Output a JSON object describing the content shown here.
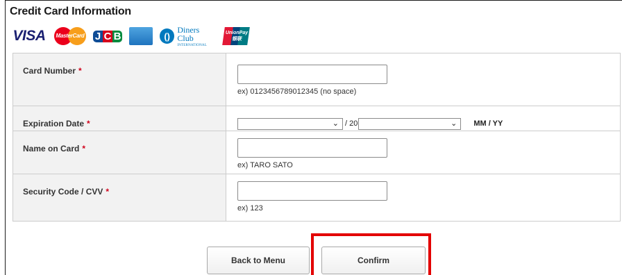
{
  "section": {
    "title": "Credit Card Information"
  },
  "logos": [
    {
      "name": "visa",
      "text": "VISA"
    },
    {
      "name": "mastercard",
      "text": "MasterCard"
    },
    {
      "name": "jcb",
      "text": "JCB"
    },
    {
      "name": "american-express",
      "text": ""
    },
    {
      "name": "diners-club",
      "text": "Diners Club",
      "subtext": "INTERNATIONAL"
    },
    {
      "name": "unionpay",
      "text": "UnionPay",
      "subtext": "银联"
    }
  ],
  "form": {
    "card_number": {
      "label": "Card Number",
      "required": "*",
      "value": "",
      "hint": "ex) 0123456789012345 (no space)"
    },
    "expiration": {
      "label": "Expiration Date",
      "required": "*",
      "month_value": "",
      "separator": "/ 20",
      "year_value": "",
      "format": "MM / YY"
    },
    "name_on_card": {
      "label": "Name on Card",
      "required": "*",
      "value": "",
      "hint": "ex) TARO SATO"
    },
    "security_code": {
      "label": "Security Code / CVV",
      "required": "*",
      "value": "",
      "hint": "ex) 123"
    }
  },
  "buttons": {
    "back": "Back to Menu",
    "confirm": "Confirm"
  },
  "colors": {
    "required": "#d0021b",
    "highlight": "#e30000",
    "label_bg": "#f2f2f2",
    "border": "#cccccc"
  }
}
